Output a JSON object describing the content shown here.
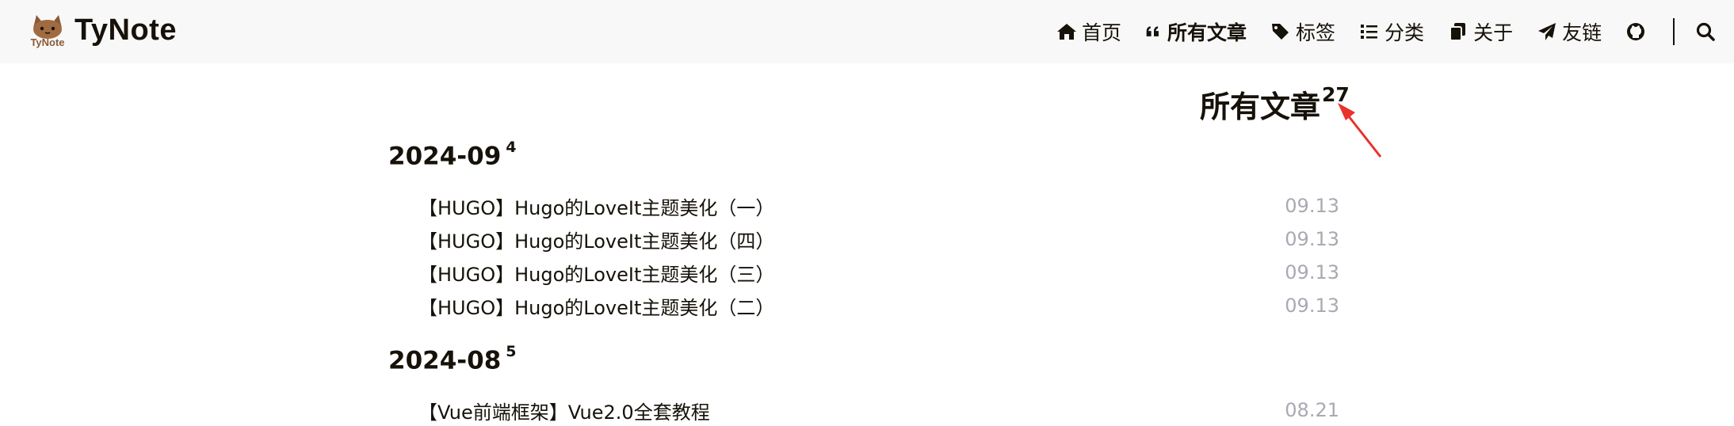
{
  "header": {
    "logo_text": "TyNote",
    "logo_badge": "TyNote",
    "nav": [
      {
        "label": "首页",
        "icon": "home-icon"
      },
      {
        "label": "所有文章",
        "icon": "quote-icon",
        "active": true
      },
      {
        "label": "标签",
        "icon": "tags-icon"
      },
      {
        "label": "分类",
        "icon": "list-icon"
      },
      {
        "label": "关于",
        "icon": "copy-icon"
      },
      {
        "label": "友链",
        "icon": "paper-plane-icon"
      }
    ],
    "github_icon": "github-icon",
    "search_icon": "search-icon"
  },
  "main": {
    "title": "所有文章",
    "count": "27",
    "groups": [
      {
        "month": "2024-09",
        "count": "4",
        "posts": [
          {
            "title": "【HUGO】Hugo的LoveIt主题美化（一）",
            "date": "09.13"
          },
          {
            "title": "【HUGO】Hugo的LoveIt主题美化（四）",
            "date": "09.13"
          },
          {
            "title": "【HUGO】Hugo的LoveIt主题美化（三）",
            "date": "09.13"
          },
          {
            "title": "【HUGO】Hugo的LoveIt主题美化（二）",
            "date": "09.13"
          }
        ]
      },
      {
        "month": "2024-08",
        "count": "5",
        "posts": [
          {
            "title": "【Vue前端框架】Vue2.0全套教程",
            "date": "08.21"
          }
        ]
      }
    ]
  },
  "colors": {
    "header_bg": "#f8f8f8",
    "text": "#161209",
    "date": "#a9a9b3",
    "annotation_arrow": "#e8322b"
  }
}
